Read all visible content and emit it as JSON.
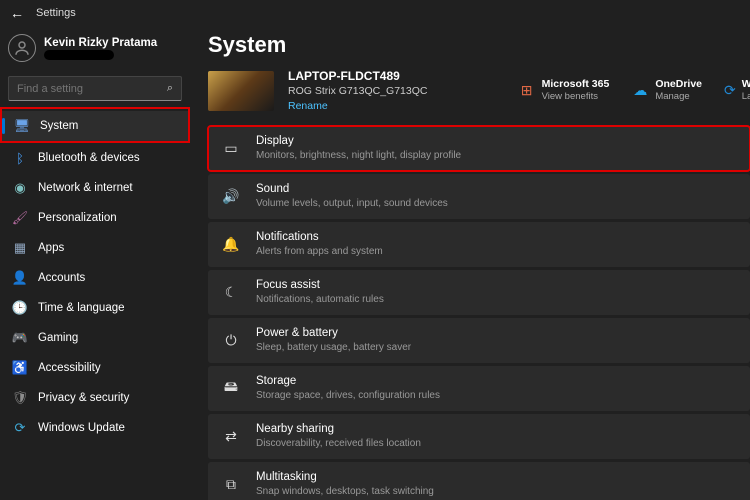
{
  "header": {
    "title": "Settings"
  },
  "profile": {
    "name": "Kevin Rizky Pratama"
  },
  "search": {
    "placeholder": "Find a setting"
  },
  "sidebar": {
    "items": [
      {
        "label": "System",
        "icon": "🖥",
        "color": "#6aa3e8",
        "active": true
      },
      {
        "label": "Bluetooth & devices",
        "icon": "ᛒ",
        "color": "#4aa3ff"
      },
      {
        "label": "Network & internet",
        "icon": "◉",
        "color": "#7ec0c0"
      },
      {
        "label": "Personalization",
        "icon": "🖌",
        "color": "#b36b9e"
      },
      {
        "label": "Apps",
        "icon": "▦",
        "color": "#8fa5bf"
      },
      {
        "label": "Accounts",
        "icon": "👤",
        "color": "#e88b7d"
      },
      {
        "label": "Time & language",
        "icon": "🕒",
        "color": "#b0b045"
      },
      {
        "label": "Gaming",
        "icon": "🎮",
        "color": "#7bc47f"
      },
      {
        "label": "Accessibility",
        "icon": "♿",
        "color": "#6a9de8"
      },
      {
        "label": "Privacy & security",
        "icon": "🛡",
        "color": "#8d8d8d"
      },
      {
        "label": "Windows Update",
        "icon": "⟳",
        "color": "#3fa9d6"
      }
    ]
  },
  "page": {
    "title": "System",
    "device": {
      "name": "LAPTOP-FLDCT489",
      "model": "ROG Strix G713QC_G713QC",
      "rename": "Rename"
    },
    "services": [
      {
        "title": "Microsoft 365",
        "sub": "View benefits",
        "icon": "⊞",
        "color": "#e06845"
      },
      {
        "title": "OneDrive",
        "sub": "Manage",
        "icon": "☁",
        "color": "#1ea0e6"
      },
      {
        "title": "Wi",
        "sub": "Las",
        "icon": "⟳",
        "color": "#2088d4"
      }
    ],
    "items": [
      {
        "title": "Display",
        "sub": "Monitors, brightness, night light, display profile",
        "icon": "▭",
        "hl": true
      },
      {
        "title": "Sound",
        "sub": "Volume levels, output, input, sound devices",
        "icon": "🔊"
      },
      {
        "title": "Notifications",
        "sub": "Alerts from apps and system",
        "icon": "🔔"
      },
      {
        "title": "Focus assist",
        "sub": "Notifications, automatic rules",
        "icon": "☾"
      },
      {
        "title": "Power & battery",
        "sub": "Sleep, battery usage, battery saver",
        "icon": "⏻"
      },
      {
        "title": "Storage",
        "sub": "Storage space, drives, configuration rules",
        "icon": "🖴"
      },
      {
        "title": "Nearby sharing",
        "sub": "Discoverability, received files location",
        "icon": "⇄"
      },
      {
        "title": "Multitasking",
        "sub": "Snap windows, desktops, task switching",
        "icon": "⧉"
      }
    ]
  }
}
